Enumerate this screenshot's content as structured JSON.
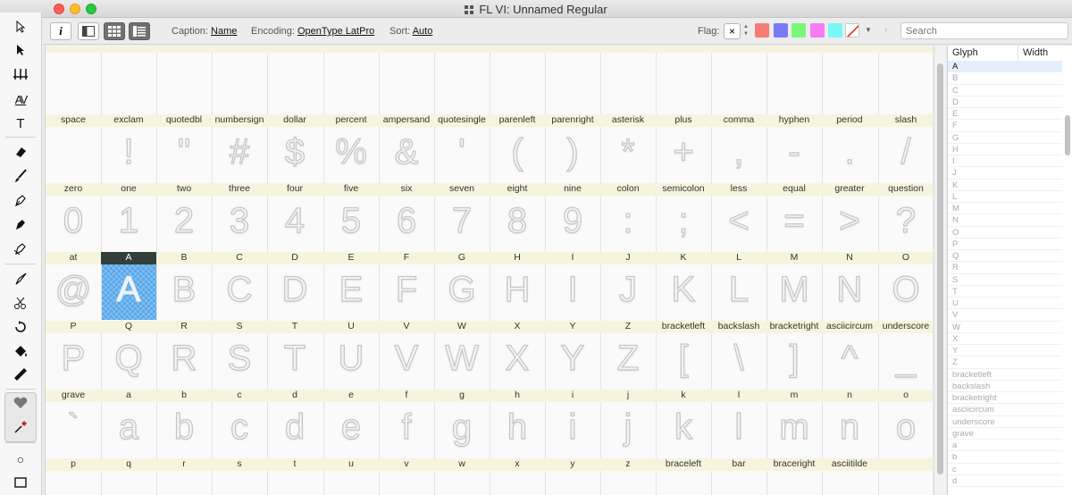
{
  "window": {
    "title": "FL VI:  Unnamed Regular"
  },
  "toolbar": {
    "info_label": "i",
    "caption_label": "Caption:",
    "caption_value": "Name",
    "encoding_label": "Encoding:",
    "encoding_value": "OpenType LatPro",
    "sort_label": "Sort:",
    "sort_value": "Auto",
    "flag_label": "Flag:",
    "flag_none": "×",
    "search_placeholder": "Search",
    "flag_colors": [
      "#f77a77",
      "#7a7af7",
      "#7af77a",
      "#f77af7",
      "#7af7f7"
    ]
  },
  "tools": [
    "pointer-icon",
    "contour-pointer-icon",
    "metrics-icon",
    "kerning-icon",
    "text-tool-icon",
    "eraser-icon",
    "brush-icon",
    "pen-icon",
    "rapid-pen-icon",
    "power-nib-icon",
    "knife-icon",
    "scissors-icon",
    "rotate-icon",
    "fill-icon",
    "ruler-icon",
    "heart-icon",
    "eyedropper-icon",
    "ellipse-icon",
    "rectangle-icon"
  ],
  "tool_glyphs": {
    "kerning": "AV",
    "text": "T",
    "ellipse": "○"
  },
  "grid": {
    "selected_glyph": "A",
    "rows": [
      {
        "captions": [
          "space",
          "exclam",
          "quotedbl",
          "numbersign",
          "dollar",
          "percent",
          "ampersand",
          "quotesingle",
          "parenleft",
          "parenright",
          "asterisk",
          "plus",
          "comma",
          "hyphen",
          "period",
          "slash"
        ],
        "glyphs": [
          "",
          "!",
          "\"",
          "#",
          "$",
          "%",
          "&",
          "'",
          "(",
          ")",
          "*",
          "+",
          ",",
          "-",
          ".",
          "/"
        ]
      },
      {
        "captions": [
          "zero",
          "one",
          "two",
          "three",
          "four",
          "five",
          "six",
          "seven",
          "eight",
          "nine",
          "colon",
          "semicolon",
          "less",
          "equal",
          "greater",
          "question"
        ],
        "glyphs": [
          "0",
          "1",
          "2",
          "3",
          "4",
          "5",
          "6",
          "7",
          "8",
          "9",
          ":",
          ";",
          "<",
          "=",
          ">",
          "?"
        ]
      },
      {
        "captions": [
          "at",
          "A",
          "B",
          "C",
          "D",
          "E",
          "F",
          "G",
          "H",
          "I",
          "J",
          "K",
          "L",
          "M",
          "N",
          "O"
        ],
        "glyphs": [
          "@",
          "A",
          "B",
          "C",
          "D",
          "E",
          "F",
          "G",
          "H",
          "I",
          "J",
          "K",
          "L",
          "M",
          "N",
          "O"
        ]
      },
      {
        "captions": [
          "P",
          "Q",
          "R",
          "S",
          "T",
          "U",
          "V",
          "W",
          "X",
          "Y",
          "Z",
          "bracketleft",
          "backslash",
          "bracketright",
          "asciicircum",
          "underscore"
        ],
        "glyphs": [
          "P",
          "Q",
          "R",
          "S",
          "T",
          "U",
          "V",
          "W",
          "X",
          "Y",
          "Z",
          "[",
          "\\",
          "]",
          "^",
          "_"
        ]
      },
      {
        "captions": [
          "grave",
          "a",
          "b",
          "c",
          "d",
          "e",
          "f",
          "g",
          "h",
          "i",
          "j",
          "k",
          "l",
          "m",
          "n",
          "o"
        ],
        "glyphs": [
          "`",
          "a",
          "b",
          "c",
          "d",
          "e",
          "f",
          "g",
          "h",
          "i",
          "j",
          "k",
          "l",
          "m",
          "n",
          "o"
        ]
      },
      {
        "captions": [
          "p",
          "q",
          "r",
          "s",
          "t",
          "u",
          "v",
          "w",
          "x",
          "y",
          "z",
          "braceleft",
          "bar",
          "braceright",
          "asciitilde",
          ""
        ],
        "glyphs": [
          "",
          "",
          "",
          "",
          "",
          "",
          "",
          "",
          "",
          "",
          "",
          "",
          "",
          "",
          "",
          ""
        ]
      }
    ]
  },
  "panel": {
    "col_glyph": "Glyph",
    "col_width": "Width",
    "items": [
      "A",
      "B",
      "C",
      "D",
      "E",
      "F",
      "G",
      "H",
      "I",
      "J",
      "K",
      "L",
      "M",
      "N",
      "O",
      "P",
      "Q",
      "R",
      "S",
      "T",
      "U",
      "V",
      "W",
      "X",
      "Y",
      "Z",
      "bracketleft",
      "backslash",
      "bracketright",
      "asciicircum",
      "underscore",
      "grave",
      "a",
      "b",
      "c",
      "d"
    ]
  }
}
